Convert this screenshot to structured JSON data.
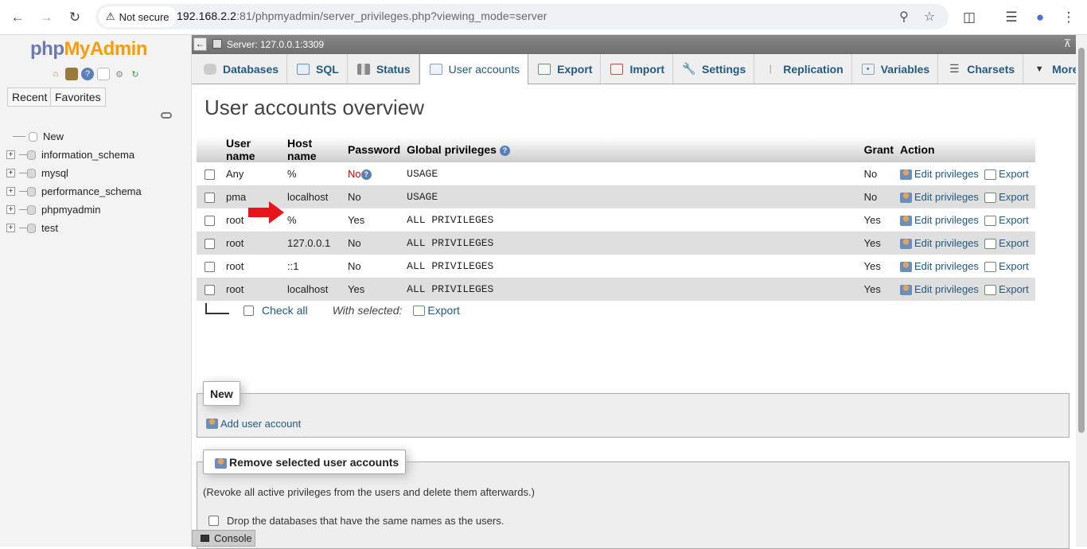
{
  "browser": {
    "security_label": "Not secure",
    "url_host": "192.168.2.2",
    "url_rest": ":81/phpmyadmin/server_privileges.php?viewing_mode=server"
  },
  "sidebar": {
    "logo_php": "php",
    "logo_myadmin": "MyAdmin",
    "recent_label": "Recent",
    "favorites_label": "Favorites",
    "tree": [
      {
        "label": "New"
      },
      {
        "label": "information_schema"
      },
      {
        "label": "mysql"
      },
      {
        "label": "performance_schema"
      },
      {
        "label": "phpmyadmin"
      },
      {
        "label": "test"
      }
    ]
  },
  "server": {
    "title": "Server: 127.0.0.1:3309"
  },
  "tabs": [
    {
      "label": "Databases"
    },
    {
      "label": "SQL"
    },
    {
      "label": "Status"
    },
    {
      "label": "User accounts"
    },
    {
      "label": "Export"
    },
    {
      "label": "Import"
    },
    {
      "label": "Settings"
    },
    {
      "label": "Replication"
    },
    {
      "label": "Variables"
    },
    {
      "label": "Charsets"
    },
    {
      "label": "More"
    }
  ],
  "page": {
    "title": "User accounts overview"
  },
  "table": {
    "headers": [
      "User name",
      "Host name",
      "Password",
      "Global privileges",
      "Grant",
      "Action"
    ],
    "rows": [
      {
        "user": "Any",
        "host": "%",
        "password": "No",
        "privileges": "USAGE",
        "grant": "No",
        "edit": "Edit privileges",
        "export": "Export"
      },
      {
        "user": "pma",
        "host": "localhost",
        "password": "No",
        "privileges": "USAGE",
        "grant": "No",
        "edit": "Edit privileges",
        "export": "Export"
      },
      {
        "user": "root",
        "host": "%",
        "password": "Yes",
        "privileges": "ALL PRIVILEGES",
        "grant": "Yes",
        "edit": "Edit privileges",
        "export": "Export"
      },
      {
        "user": "root",
        "host": "127.0.0.1",
        "password": "No",
        "privileges": "ALL PRIVILEGES",
        "grant": "Yes",
        "edit": "Edit privileges",
        "export": "Export"
      },
      {
        "user": "root",
        "host": "::1",
        "password": "No",
        "privileges": "ALL PRIVILEGES",
        "grant": "Yes",
        "edit": "Edit privileges",
        "export": "Export"
      },
      {
        "user": "root",
        "host": "localhost",
        "password": "Yes",
        "privileges": "ALL PRIVILEGES",
        "grant": "Yes",
        "edit": "Edit privileges",
        "export": "Export"
      }
    ],
    "check_all": "Check all",
    "with_selected": "With selected:",
    "export_selected": "Export"
  },
  "new_section": {
    "legend": "New",
    "add_user": "Add user account"
  },
  "remove_section": {
    "legend": "Remove selected user accounts",
    "description": "(Revoke all active privileges from the users and delete them afterwards.)",
    "drop_db_label": "Drop the databases that have the same names as the users."
  },
  "console": {
    "label": "Console"
  },
  "colors": {
    "link": "#235a81",
    "red": "#cc0000",
    "logo_blue": "#6c78af",
    "logo_orange": "#f89c0e"
  }
}
